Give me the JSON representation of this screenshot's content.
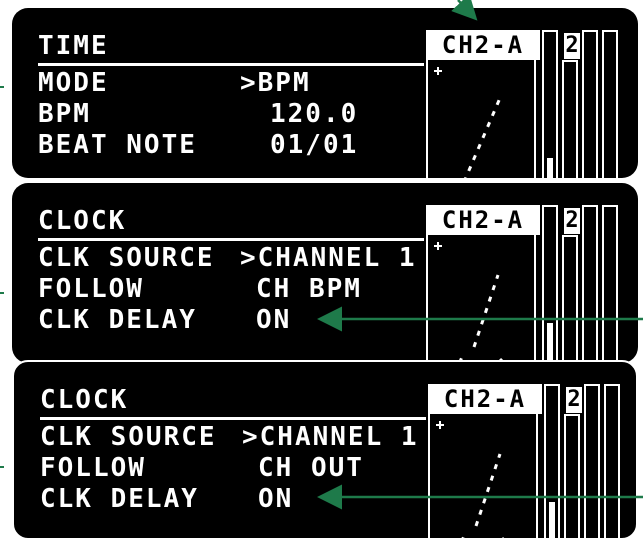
{
  "screens": [
    {
      "title": "TIME",
      "rows": [
        {
          "label": "MODE",
          "value": ">BPM"
        },
        {
          "label": "BPM",
          "value": "120.0"
        },
        {
          "label": "BEAT NOTE",
          "value": "01/01"
        }
      ],
      "channel": "CH2-A",
      "meter_number": "2"
    },
    {
      "title": "CLOCK",
      "rows": [
        {
          "label": "CLK SOURCE",
          "value": ">CHANNEL 1"
        },
        {
          "label": "FOLLOW",
          "value": "CH BPM"
        },
        {
          "label": "CLK DELAY",
          "value": "ON"
        }
      ],
      "channel": "CH2-A",
      "meter_number": "2"
    },
    {
      "title": "CLOCK",
      "rows": [
        {
          "label": "CLK SOURCE",
          "value": ">CHANNEL 1"
        },
        {
          "label": "FOLLOW",
          "value": "CH OUT"
        },
        {
          "label": "CLK DELAY",
          "value": "ON"
        }
      ],
      "channel": "CH2-A",
      "meter_number": "2"
    }
  ],
  "colors": {
    "screen_bg": "#000000",
    "text": "#ffffff",
    "annotation_arrow": "#1e7a4a"
  },
  "icons": [
    "cursor-plus-icon",
    "annotation-arrow-icon"
  ]
}
